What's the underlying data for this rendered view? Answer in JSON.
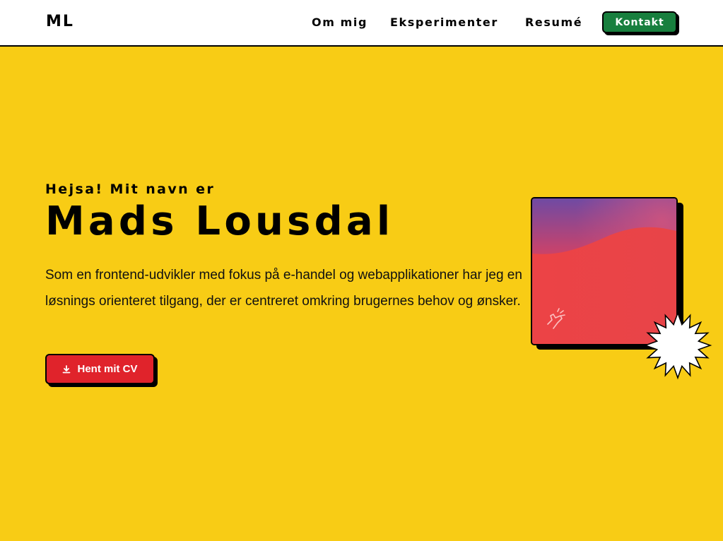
{
  "header": {
    "logo": "ML",
    "nav": {
      "om_mig": "Om mig",
      "eksperimenter": "Eksperimenter",
      "resume": "Resumé"
    },
    "contact_label": "Kontakt"
  },
  "hero": {
    "greeting": "Hejsa! Mit navn er",
    "name": "Mads Lousdal",
    "intro": "Som en frontend-udvikler med fokus på e-handel og webapplikationer har jeg en løsnings orienteret tilgang, der er centreret omkring brugernes behov og ønsker.",
    "cv_button_label": "Hent mit CV"
  },
  "icons": {
    "download": "download-icon",
    "snap": "finger-snap-icon"
  },
  "colors": {
    "background": "#f8cc15",
    "header": "#ffffff",
    "contact_button": "#187f3e",
    "cv_button": "#e0232b",
    "card_gradient_top": "#7a4aa0",
    "card_gradient_bottom": "#ea4144"
  }
}
